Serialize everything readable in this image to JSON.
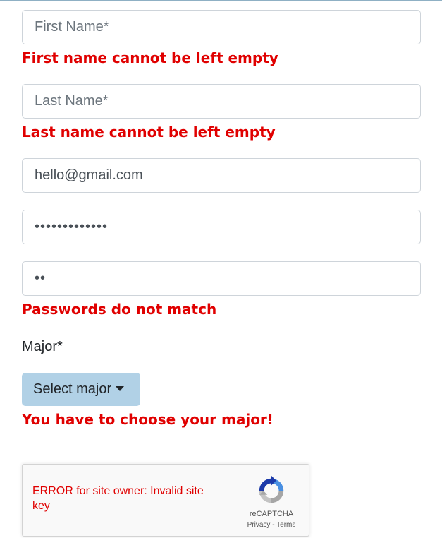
{
  "form": {
    "first_name": {
      "placeholder": "First Name*",
      "error": "First name cannot be left empty"
    },
    "last_name": {
      "placeholder": "Last Name*",
      "error": "Last name cannot be left empty"
    },
    "email": {
      "value": "hello@gmail.com"
    },
    "password": {
      "value": "•••••••••••••"
    },
    "confirm_password": {
      "value": "••",
      "error": "Passwords do not match"
    },
    "major": {
      "label": "Major*",
      "button_label": "Select major",
      "error": "You have to choose your major!"
    }
  },
  "recaptcha": {
    "error": "ERROR for site owner: Invalid site key",
    "brand": "reCAPTCHA",
    "privacy": "Privacy",
    "separator": "-",
    "terms": "Terms"
  },
  "colors": {
    "error": "#e00000",
    "dropdown_bg": "#b1d1e6",
    "input_border": "#ced4da"
  },
  "icons": {
    "recaptcha": "recaptcha-logo-icon",
    "dropdown": "caret-down-icon"
  }
}
